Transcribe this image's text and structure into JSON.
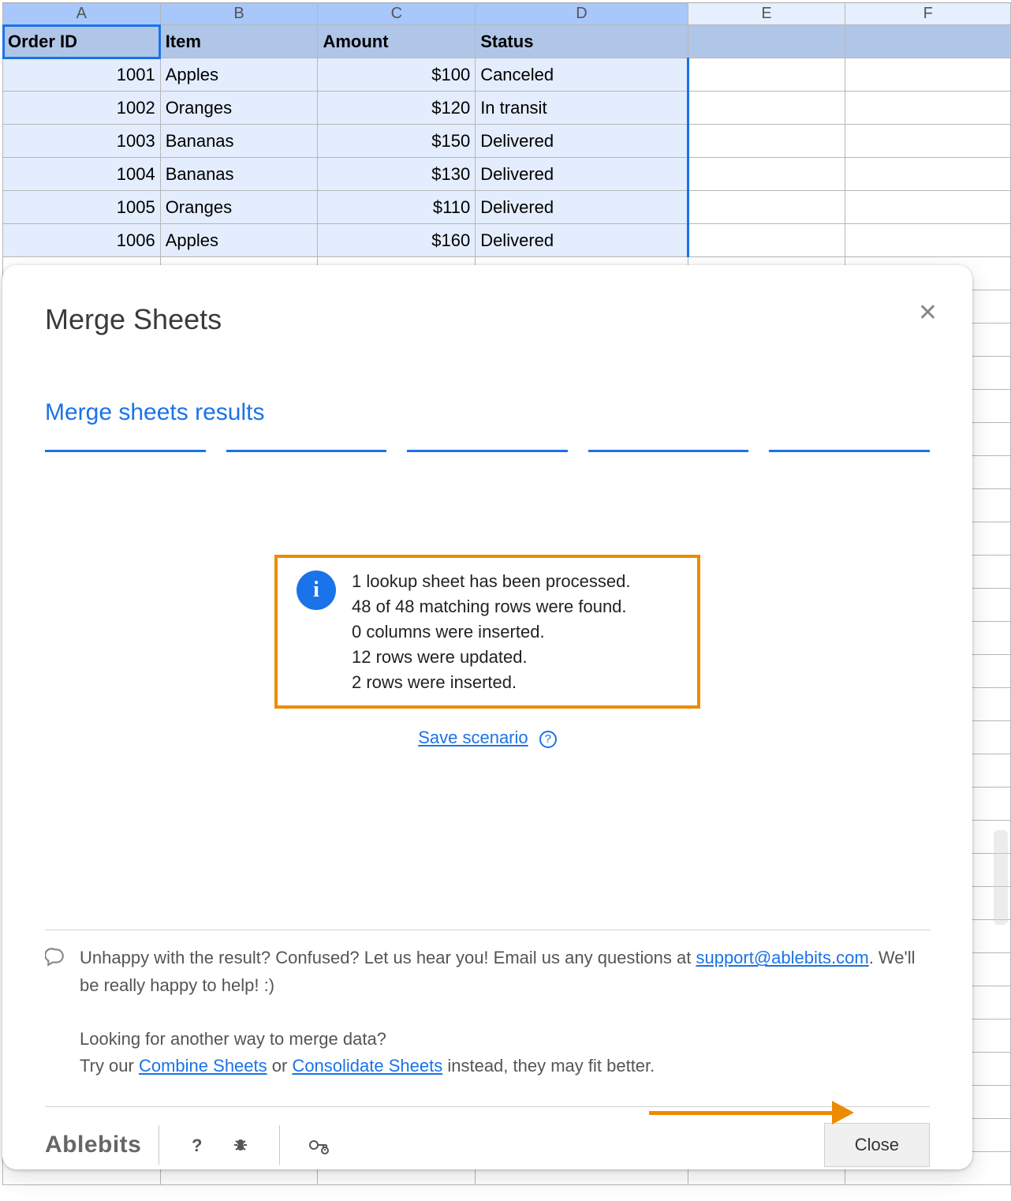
{
  "sheet": {
    "columns": [
      "A",
      "B",
      "C",
      "D",
      "E",
      "F"
    ],
    "headers": {
      "A": "Order ID",
      "B": "Item",
      "C": "Amount",
      "D": "Status"
    },
    "rows": [
      {
        "A": "1001",
        "B": "Apples",
        "C": "$100",
        "D": "Canceled"
      },
      {
        "A": "1002",
        "B": "Oranges",
        "C": "$120",
        "D": "In transit"
      },
      {
        "A": "1003",
        "B": "Bananas",
        "C": "$150",
        "D": "Delivered"
      },
      {
        "A": "1004",
        "B": "Bananas",
        "C": "$130",
        "D": "Delivered"
      },
      {
        "A": "1005",
        "B": "Oranges",
        "C": "$110",
        "D": "Delivered"
      },
      {
        "A": "1006",
        "B": "Apples",
        "C": "$160",
        "D": "Delivered"
      }
    ]
  },
  "dialog": {
    "title": "Merge Sheets",
    "subtitle": "Merge sheets results",
    "result_lines": [
      "1 lookup sheet has been processed.",
      "48 of 48 matching rows were found.",
      "0 columns were inserted.",
      "12 rows were updated.",
      "2 rows were inserted."
    ],
    "save_scenario": "Save scenario",
    "help": {
      "unhappy_pre": "Unhappy with the result? Confused? Let us hear you! Email us any questions at ",
      "support_email": "support@ablebits.com",
      "unhappy_post": ". We'll be really happy to help! :)",
      "alt_pre": "Looking for another way to merge data?",
      "alt_try": "Try our ",
      "combine": "Combine Sheets",
      "or": " or ",
      "consolidate": "Consolidate Sheets",
      "alt_tail": " instead, they may fit better."
    },
    "brand": "Ablebits",
    "close_label": "Close"
  }
}
